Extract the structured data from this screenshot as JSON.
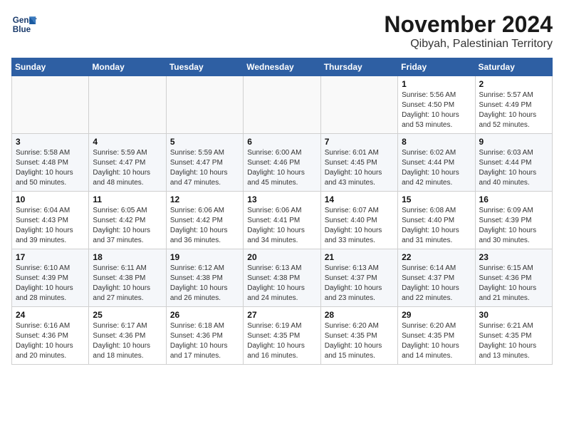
{
  "header": {
    "logo_line1": "General",
    "logo_line2": "Blue",
    "month": "November 2024",
    "location": "Qibyah, Palestinian Territory"
  },
  "weekdays": [
    "Sunday",
    "Monday",
    "Tuesday",
    "Wednesday",
    "Thursday",
    "Friday",
    "Saturday"
  ],
  "weeks": [
    [
      {
        "day": "",
        "info": ""
      },
      {
        "day": "",
        "info": ""
      },
      {
        "day": "",
        "info": ""
      },
      {
        "day": "",
        "info": ""
      },
      {
        "day": "",
        "info": ""
      },
      {
        "day": "1",
        "info": "Sunrise: 5:56 AM\nSunset: 4:50 PM\nDaylight: 10 hours\nand 53 minutes."
      },
      {
        "day": "2",
        "info": "Sunrise: 5:57 AM\nSunset: 4:49 PM\nDaylight: 10 hours\nand 52 minutes."
      }
    ],
    [
      {
        "day": "3",
        "info": "Sunrise: 5:58 AM\nSunset: 4:48 PM\nDaylight: 10 hours\nand 50 minutes."
      },
      {
        "day": "4",
        "info": "Sunrise: 5:59 AM\nSunset: 4:47 PM\nDaylight: 10 hours\nand 48 minutes."
      },
      {
        "day": "5",
        "info": "Sunrise: 5:59 AM\nSunset: 4:47 PM\nDaylight: 10 hours\nand 47 minutes."
      },
      {
        "day": "6",
        "info": "Sunrise: 6:00 AM\nSunset: 4:46 PM\nDaylight: 10 hours\nand 45 minutes."
      },
      {
        "day": "7",
        "info": "Sunrise: 6:01 AM\nSunset: 4:45 PM\nDaylight: 10 hours\nand 43 minutes."
      },
      {
        "day": "8",
        "info": "Sunrise: 6:02 AM\nSunset: 4:44 PM\nDaylight: 10 hours\nand 42 minutes."
      },
      {
        "day": "9",
        "info": "Sunrise: 6:03 AM\nSunset: 4:44 PM\nDaylight: 10 hours\nand 40 minutes."
      }
    ],
    [
      {
        "day": "10",
        "info": "Sunrise: 6:04 AM\nSunset: 4:43 PM\nDaylight: 10 hours\nand 39 minutes."
      },
      {
        "day": "11",
        "info": "Sunrise: 6:05 AM\nSunset: 4:42 PM\nDaylight: 10 hours\nand 37 minutes."
      },
      {
        "day": "12",
        "info": "Sunrise: 6:06 AM\nSunset: 4:42 PM\nDaylight: 10 hours\nand 36 minutes."
      },
      {
        "day": "13",
        "info": "Sunrise: 6:06 AM\nSunset: 4:41 PM\nDaylight: 10 hours\nand 34 minutes."
      },
      {
        "day": "14",
        "info": "Sunrise: 6:07 AM\nSunset: 4:40 PM\nDaylight: 10 hours\nand 33 minutes."
      },
      {
        "day": "15",
        "info": "Sunrise: 6:08 AM\nSunset: 4:40 PM\nDaylight: 10 hours\nand 31 minutes."
      },
      {
        "day": "16",
        "info": "Sunrise: 6:09 AM\nSunset: 4:39 PM\nDaylight: 10 hours\nand 30 minutes."
      }
    ],
    [
      {
        "day": "17",
        "info": "Sunrise: 6:10 AM\nSunset: 4:39 PM\nDaylight: 10 hours\nand 28 minutes."
      },
      {
        "day": "18",
        "info": "Sunrise: 6:11 AM\nSunset: 4:38 PM\nDaylight: 10 hours\nand 27 minutes."
      },
      {
        "day": "19",
        "info": "Sunrise: 6:12 AM\nSunset: 4:38 PM\nDaylight: 10 hours\nand 26 minutes."
      },
      {
        "day": "20",
        "info": "Sunrise: 6:13 AM\nSunset: 4:38 PM\nDaylight: 10 hours\nand 24 minutes."
      },
      {
        "day": "21",
        "info": "Sunrise: 6:13 AM\nSunset: 4:37 PM\nDaylight: 10 hours\nand 23 minutes."
      },
      {
        "day": "22",
        "info": "Sunrise: 6:14 AM\nSunset: 4:37 PM\nDaylight: 10 hours\nand 22 minutes."
      },
      {
        "day": "23",
        "info": "Sunrise: 6:15 AM\nSunset: 4:36 PM\nDaylight: 10 hours\nand 21 minutes."
      }
    ],
    [
      {
        "day": "24",
        "info": "Sunrise: 6:16 AM\nSunset: 4:36 PM\nDaylight: 10 hours\nand 20 minutes."
      },
      {
        "day": "25",
        "info": "Sunrise: 6:17 AM\nSunset: 4:36 PM\nDaylight: 10 hours\nand 18 minutes."
      },
      {
        "day": "26",
        "info": "Sunrise: 6:18 AM\nSunset: 4:36 PM\nDaylight: 10 hours\nand 17 minutes."
      },
      {
        "day": "27",
        "info": "Sunrise: 6:19 AM\nSunset: 4:35 PM\nDaylight: 10 hours\nand 16 minutes."
      },
      {
        "day": "28",
        "info": "Sunrise: 6:20 AM\nSunset: 4:35 PM\nDaylight: 10 hours\nand 15 minutes."
      },
      {
        "day": "29",
        "info": "Sunrise: 6:20 AM\nSunset: 4:35 PM\nDaylight: 10 hours\nand 14 minutes."
      },
      {
        "day": "30",
        "info": "Sunrise: 6:21 AM\nSunset: 4:35 PM\nDaylight: 10 hours\nand 13 minutes."
      }
    ]
  ]
}
